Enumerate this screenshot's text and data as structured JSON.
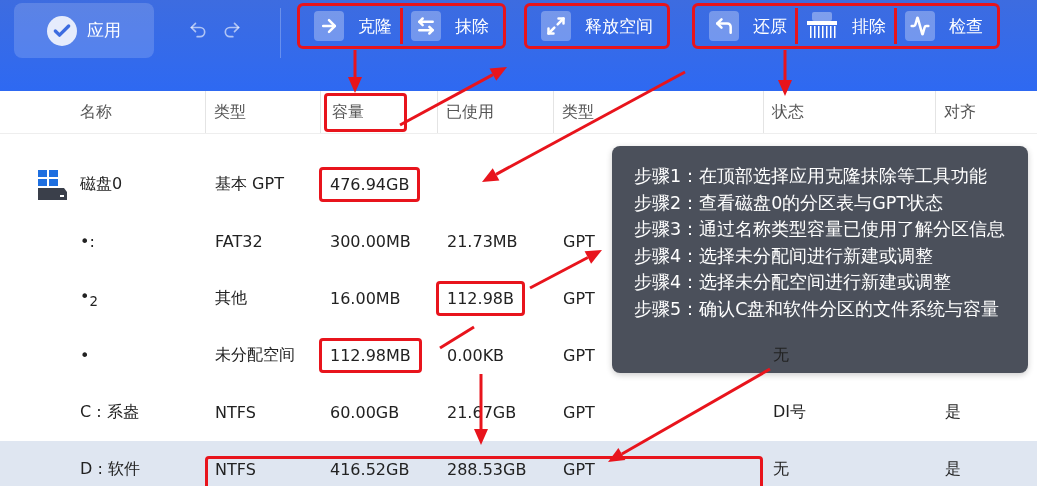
{
  "toolbar": {
    "apply": {
      "label": "应用"
    },
    "tool_groups": [
      {
        "highlighted": true,
        "tools": [
          {
            "kind": "clone",
            "label": "克隆"
          },
          {
            "kind": "wipe",
            "label": "抹除"
          }
        ]
      },
      {
        "highlighted": true,
        "tools": [
          {
            "kind": "release",
            "label": "释放空间"
          }
        ]
      },
      {
        "highlighted": true,
        "tools": [
          {
            "kind": "restore",
            "label": "还原"
          },
          {
            "kind": "exclude",
            "label": "排除"
          },
          {
            "kind": "check",
            "label": "检查"
          }
        ]
      }
    ]
  },
  "table": {
    "columns": [
      {
        "label": "名称",
        "highlighted": false
      },
      {
        "label": "类型",
        "highlighted": false
      },
      {
        "label": "容量",
        "highlighted": true
      },
      {
        "label": "已使用",
        "highlighted": false
      },
      {
        "label": "类型",
        "highlighted": false
      },
      {
        "label": "状态",
        "highlighted": false
      },
      {
        "label": "对齐",
        "highlighted": false
      }
    ],
    "rows": [
      {
        "kind": "disk",
        "name": "磁盘0",
        "type": "基本 GPT",
        "capacity": "476.94GB",
        "capacity_marked": true,
        "selected": false,
        "children": [
          {
            "kind": "partition",
            "name": "•:",
            "type": "FAT32",
            "capacity": "300.00MB",
            "used": "21.73MB",
            "table_type": "GPT",
            "selected": false
          },
          {
            "kind": "partition",
            "name": "•$_{2}$",
            "type": "其他",
            "capacity": "16.00MB",
            "used": "112.98B",
            "table_type": "GPT",
            "used_marked": true,
            "selected": false
          },
          {
            "kind": "partition",
            "name": "•",
            "type": "未分配空间",
            "capacity": "112.98MB",
            "used": "0.00KB",
            "table_type": "GPT",
            "status": "无",
            "capacity_marked": true,
            "selected": false
          },
          {
            "kind": "partition",
            "name": "C : 系盎",
            "type": "NTFS",
            "capacity": "60.00GB",
            "used": "21.67GB",
            "table_type": "GPT",
            "status": "DI号",
            "align": "是",
            "selected": false
          },
          {
            "kind": "partition",
            "name": "D : 软件",
            "type": "NTFS",
            "capacity": "416.52GB",
            "used": "288.53GB",
            "table_type": "GPT",
            "status": "无",
            "align": "是",
            "span_marked": true,
            "selected": true
          }
        ]
      }
    ]
  },
  "tooltip": {
    "lines": [
      "步骤1：在顶部选择应用克隆抹除等工具功能",
      "步骤2：查看磁盘0的分区表与GPT状态",
      "步骤3：通过名称类型容量已使用了解分区信息",
      "步骤4：选择未分配间进行新建或调整",
      "步骤4：选择未分配空间进行新建或调整",
      "步骤5：确认C盘和软件分区的文件系统与容量"
    ]
  }
}
